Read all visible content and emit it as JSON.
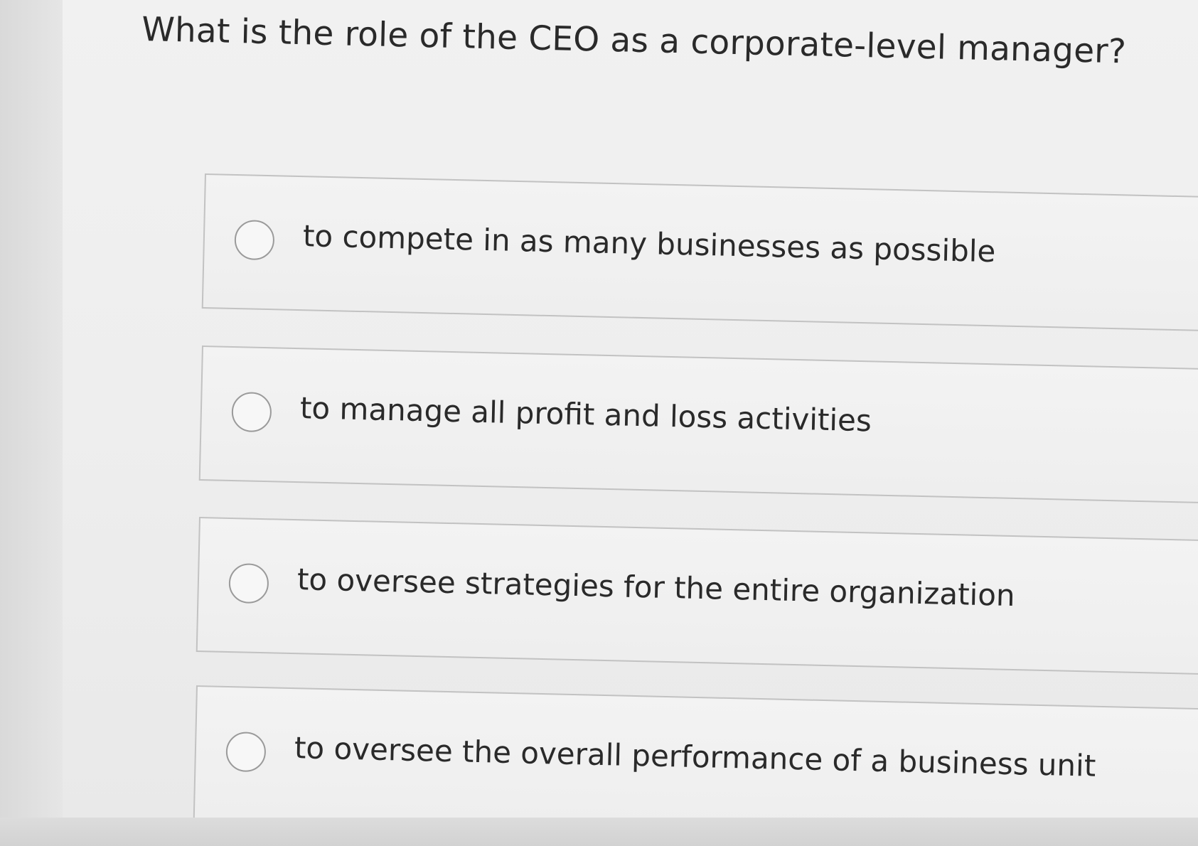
{
  "question": {
    "text": "What is the role of the CEO as a corporate-level manager?"
  },
  "options": [
    {
      "label": "to compete in as many businesses as possible",
      "selected": false
    },
    {
      "label": "to manage all profit and loss activities",
      "selected": false
    },
    {
      "label": "to oversee strategies for the entire organization",
      "selected": false
    },
    {
      "label": "to oversee the overall performance of a business unit",
      "selected": false
    }
  ]
}
